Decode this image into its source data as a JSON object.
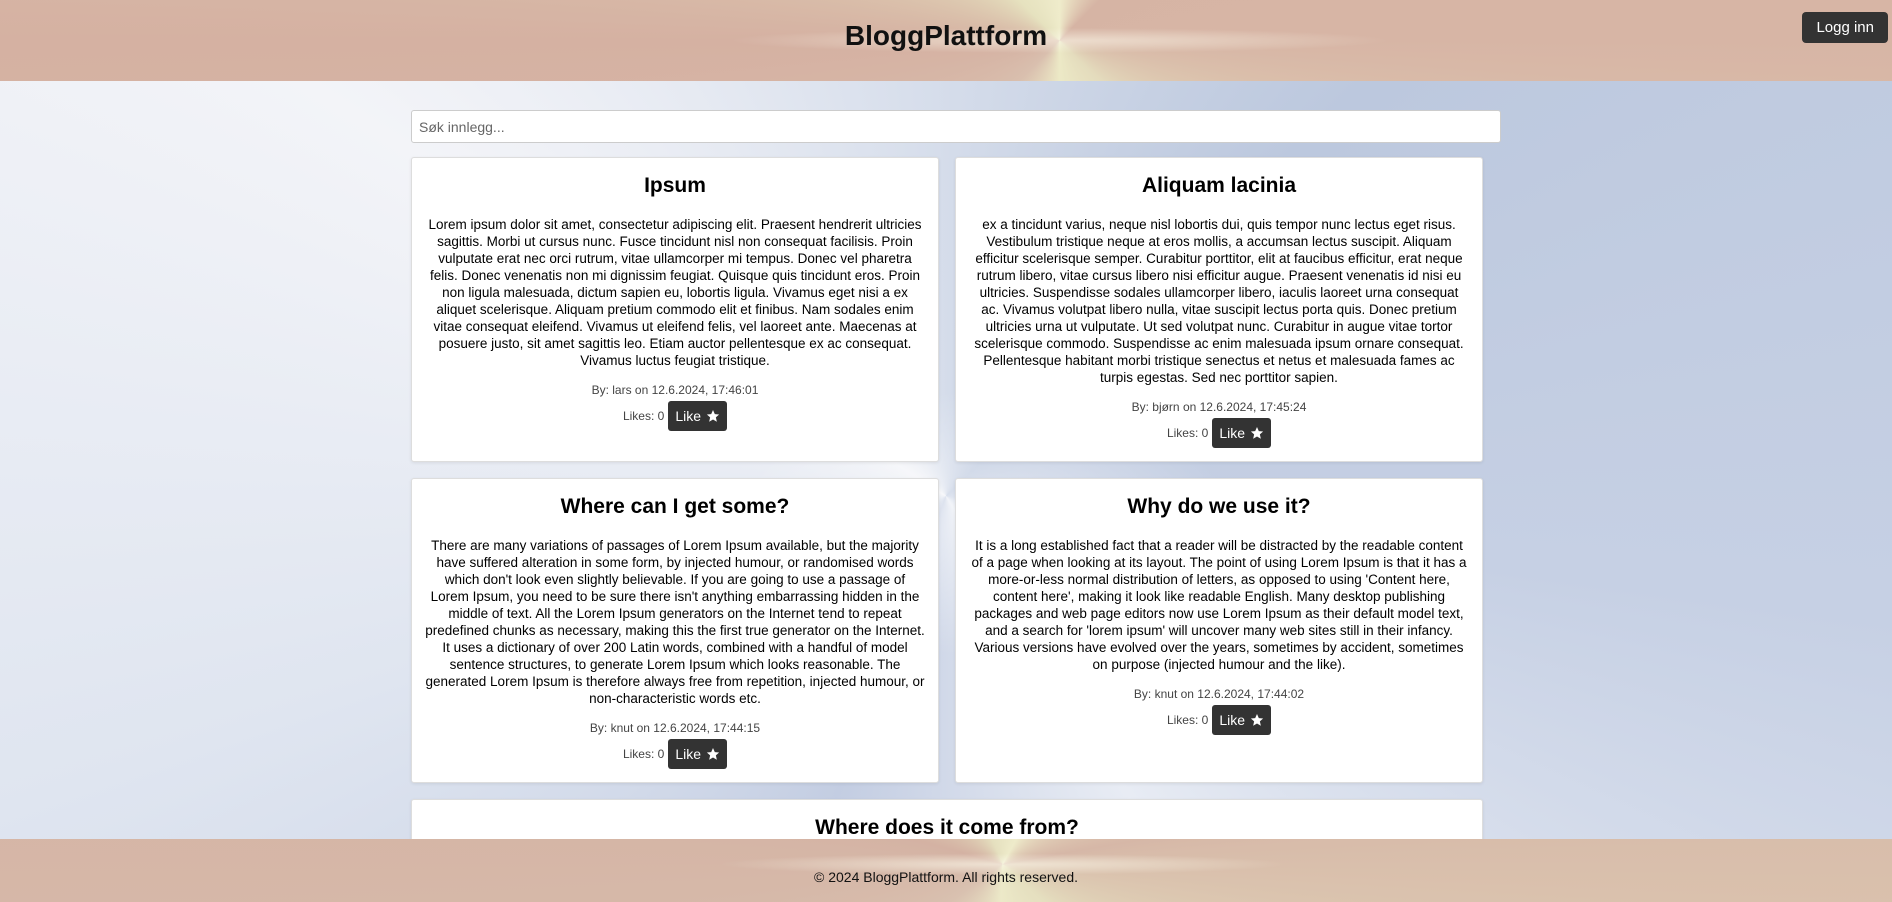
{
  "header": {
    "title": "BloggPlattform",
    "login_label": "Logg inn"
  },
  "search": {
    "placeholder": "Søk innlegg...",
    "value": ""
  },
  "posts": [
    {
      "title": "Ipsum",
      "body": "Lorem ipsum dolor sit amet, consectetur adipiscing elit. Praesent hendrerit ultricies sagittis. Morbi ut cursus nunc. Fusce tincidunt nisl non consequat facilisis. Proin vulputate erat nec orci rutrum, vitae ullamcorper mi tempus. Donec vel pharetra felis. Donec venenatis non mi dignissim feugiat. Quisque quis tincidunt eros. Proin non ligula malesuada, dictum sapien eu, lobortis ligula. Vivamus eget nisi a ex aliquet scelerisque. Aliquam pretium commodo elit et finibus. Nam sodales enim vitae consequat eleifend. Vivamus ut eleifend felis, vel laoreet ante. Maecenas at posuere justo, sit amet sagittis leo. Etiam auctor pellentesque ex ac consequat. Vivamus luctus feugiat tristique.",
      "meta": "By: lars on 12.6.2024, 17:46:01",
      "likes": "Likes: 0",
      "like_label": "Like"
    },
    {
      "title": "Aliquam lacinia",
      "body": "ex a tincidunt varius, neque nisl lobortis dui, quis tempor nunc lectus eget risus. Vestibulum tristique neque at eros mollis, a accumsan lectus suscipit. Aliquam efficitur scelerisque semper. Curabitur porttitor, elit at faucibus efficitur, erat neque rutrum libero, vitae cursus libero nisi efficitur augue. Praesent venenatis id nisi eu ultricies. Suspendisse sodales ullamcorper libero, iaculis laoreet urna consequat ac. Vivamus volutpat libero nulla, vitae suscipit lectus porta quis. Donec pretium ultricies urna ut vulputate. Ut sed volutpat nunc. Curabitur in augue vitae tortor scelerisque commodo. Suspendisse ac enim malesuada ipsum ornare consequat. Pellentesque habitant morbi tristique senectus et netus et malesuada fames ac turpis egestas. Sed nec porttitor sapien.",
      "meta": "By: bjørn on 12.6.2024, 17:45:24",
      "likes": "Likes: 0",
      "like_label": "Like"
    },
    {
      "title": "Where can I get some?",
      "body": "There are many variations of passages of Lorem Ipsum available, but the majority have suffered alteration in some form, by injected humour, or randomised words which don't look even slightly believable. If you are going to use a passage of Lorem Ipsum, you need to be sure there isn't anything embarrassing hidden in the middle of text. All the Lorem Ipsum generators on the Internet tend to repeat predefined chunks as necessary, making this the first true generator on the Internet. It uses a dictionary of over 200 Latin words, combined with a handful of model sentence structures, to generate Lorem Ipsum which looks reasonable. The generated Lorem Ipsum is therefore always free from repetition, injected humour, or non-characteristic words etc.",
      "meta": "By: knut on 12.6.2024, 17:44:15",
      "likes": "Likes: 0",
      "like_label": "Like"
    },
    {
      "title": "Why do we use it?",
      "body": "It is a long established fact that a reader will be distracted by the readable content of a page when looking at its layout. The point of using Lorem Ipsum is that it has a more-or-less normal distribution of letters, as opposed to using 'Content here, content here', making it look like readable English. Many desktop publishing packages and web page editors now use Lorem Ipsum as their default model text, and a search for 'lorem ipsum' will uncover many web sites still in their infancy. Various versions have evolved over the years, sometimes by accident, sometimes on purpose (injected humour and the like).",
      "meta": "By: knut on 12.6.2024, 17:44:02",
      "likes": "Likes: 0",
      "like_label": "Like"
    },
    {
      "title": "Where does it come from?"
    }
  ],
  "footer": {
    "text": "© 2024 BloggPlattform. All rights reserved."
  },
  "icons": {
    "like": "star-icon"
  },
  "colors": {
    "button_bg": "#333333",
    "card_bg": "#ffffff"
  }
}
